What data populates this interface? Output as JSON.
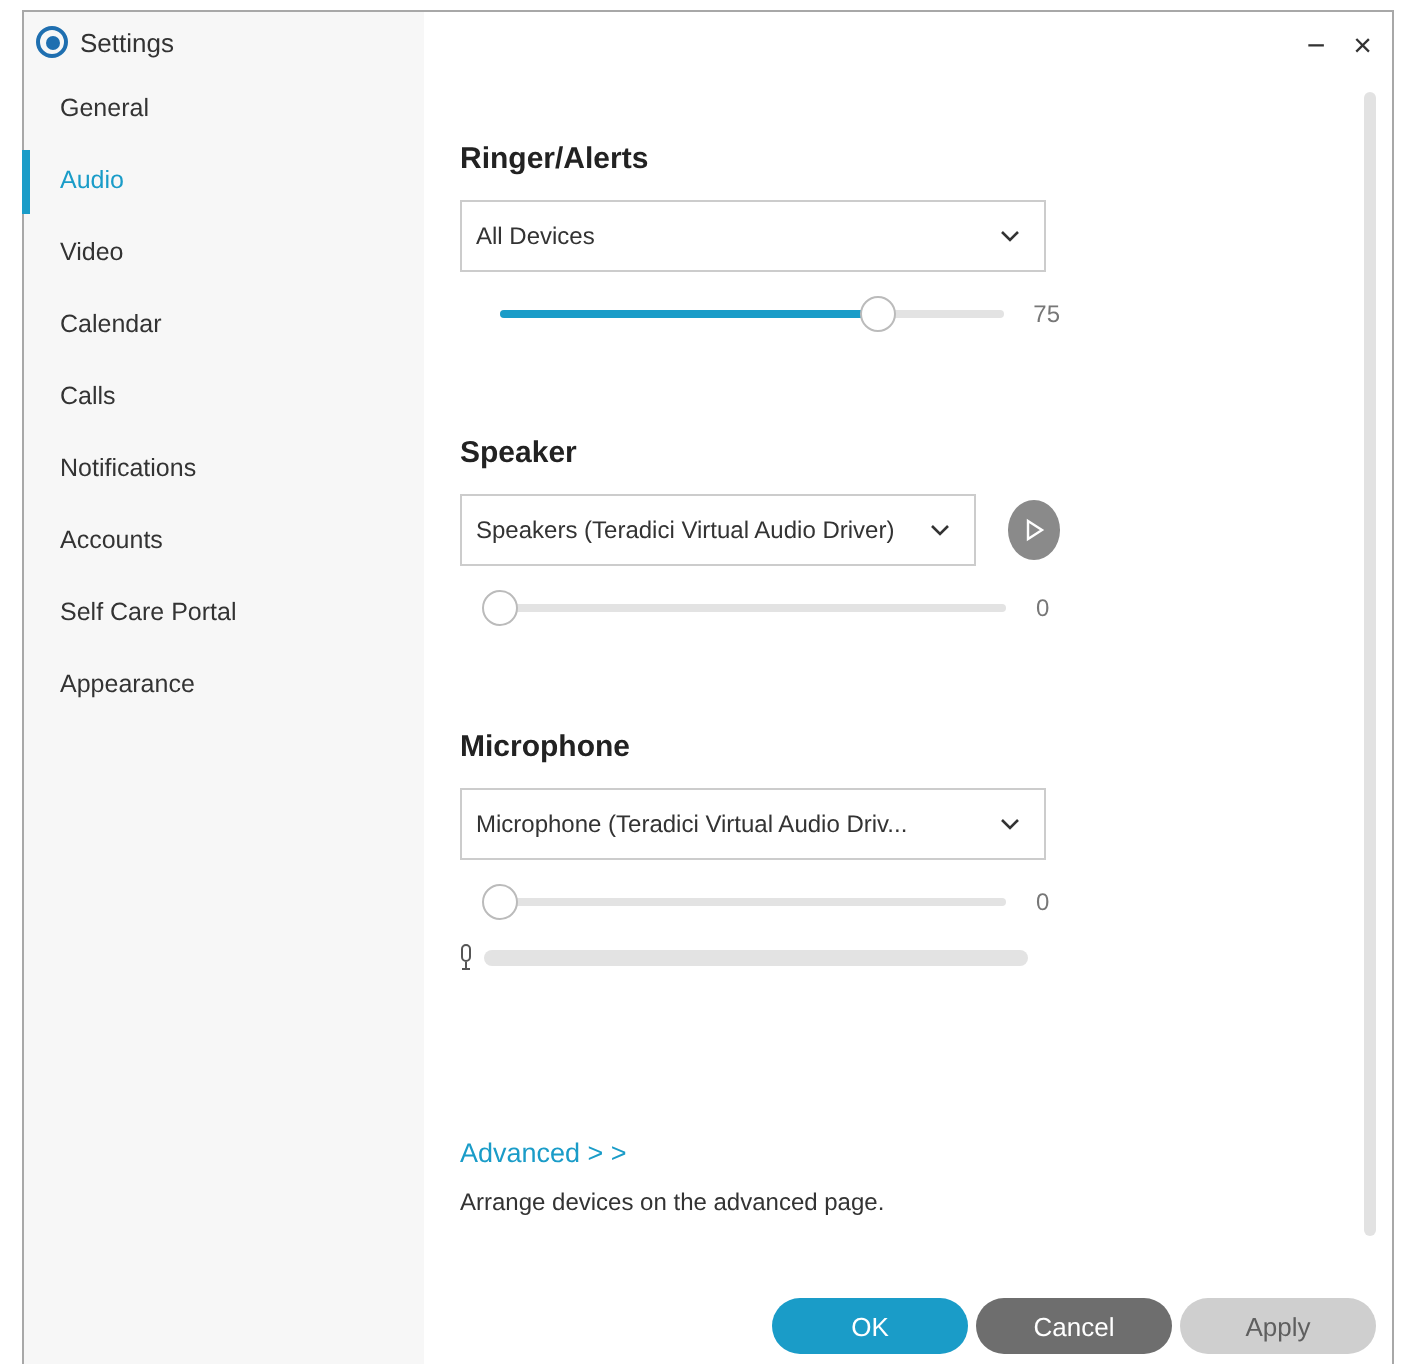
{
  "window": {
    "title": "Settings",
    "minimize": "−",
    "close": "×"
  },
  "sidebar": {
    "items": [
      {
        "label": "General",
        "selected": false
      },
      {
        "label": "Audio",
        "selected": true
      },
      {
        "label": "Video",
        "selected": false
      },
      {
        "label": "Calendar",
        "selected": false
      },
      {
        "label": "Calls",
        "selected": false
      },
      {
        "label": "Notifications",
        "selected": false
      },
      {
        "label": "Accounts",
        "selected": false
      },
      {
        "label": "Self Care Portal",
        "selected": false
      },
      {
        "label": "Appearance",
        "selected": false
      }
    ]
  },
  "sections": [
    {
      "heading": "Ringer/Alerts",
      "device": "All Devices",
      "play_button": false,
      "volume": {
        "level": 0.75,
        "reading": "75"
      }
    },
    {
      "heading": "Speaker",
      "device": "Speakers (Teradici Virtual Audio Driver)",
      "play_button": true,
      "volume": {
        "level": 0,
        "reading": "0"
      }
    },
    {
      "heading": "Microphone",
      "device": "Microphone (Teradici Virtual Audio Driv...",
      "play_button": false,
      "volume": {
        "level": 0,
        "reading": "0"
      },
      "input_meter": {
        "level": 0
      }
    }
  ],
  "advanced": {
    "link": "Advanced > >",
    "description": "Arrange devices on the advanced page."
  },
  "buttons": [
    {
      "label": "OK",
      "kind": "primary",
      "disabled": false
    },
    {
      "label": "Cancel",
      "kind": "secondary",
      "disabled": false
    },
    {
      "label": "Apply",
      "kind": "secondary",
      "disabled": true
    }
  ]
}
